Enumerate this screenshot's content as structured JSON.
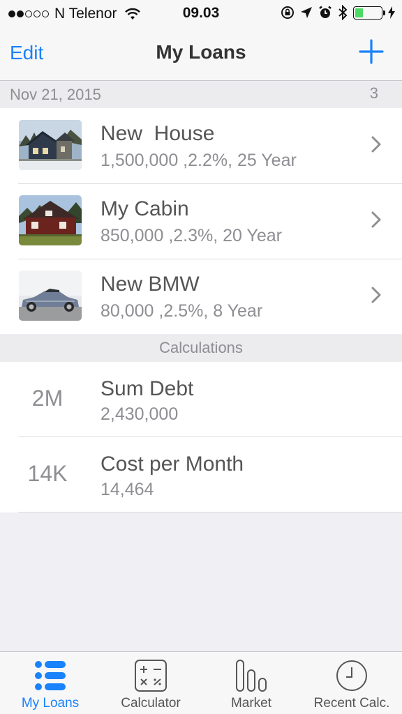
{
  "status_bar": {
    "carrier": "N Telenor",
    "time": "09.03",
    "signal_bars_filled": 2,
    "signal_bars_total": 5,
    "battery_level": 0.3,
    "battery_color": "#4cd964"
  },
  "nav": {
    "edit_label": "Edit",
    "title": "My Loans",
    "add_icon": "plus-icon",
    "accent_color": "#1a82fb"
  },
  "loans_section": {
    "date": "Nov 21, 2015",
    "count": "3"
  },
  "loans": [
    {
      "title": "New  House",
      "subtitle": "1,500,000 ,2.2%, 25 Year",
      "thumbnail": "house-photo"
    },
    {
      "title": "My Cabin",
      "subtitle": "850,000 ,2.3%, 20 Year",
      "thumbnail": "cabin-photo"
    },
    {
      "title": "New BMW",
      "subtitle": "80,000 ,2.5%, 8 Year",
      "thumbnail": "car-photo"
    }
  ],
  "calc_section": {
    "header": "Calculations"
  },
  "calculations": [
    {
      "badge": "2M",
      "title": "Sum Debt",
      "value": "2,430,000"
    },
    {
      "badge": "14K",
      "title": "Cost per Month",
      "value": "14,464"
    }
  ],
  "tabs": [
    {
      "label": "My Loans",
      "icon": "list-icon",
      "active": true
    },
    {
      "label": "Calculator",
      "icon": "calculator-icon",
      "active": false
    },
    {
      "label": "Market",
      "icon": "bar-chart-icon",
      "active": false
    },
    {
      "label": "Recent Calc.",
      "icon": "clock-icon",
      "active": false
    }
  ]
}
